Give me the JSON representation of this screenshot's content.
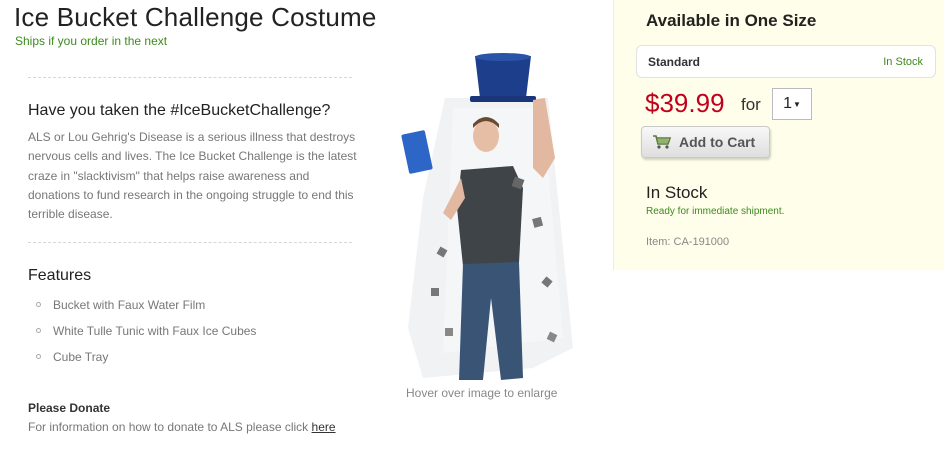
{
  "product": {
    "title": "Ice Bucket Challenge Costume",
    "ships_note": "Ships if you order in the next"
  },
  "description": {
    "heading": "Have you taken the #IceBucketChallenge?",
    "text": "ALS or Lou Gehrig's Disease is a serious illness that destroys nervous cells and lives. The Ice Bucket Challenge is the latest craze in \"slacktivism\" that helps raise awareness and donations to fund research in the ongoing struggle to end this terrible disease."
  },
  "features": {
    "heading": "Features",
    "items": [
      "Bucket with Faux Water Film",
      "White Tulle Tunic with Faux Ice Cubes",
      "Cube Tray"
    ]
  },
  "donate": {
    "heading": "Please Donate",
    "text": "For information on how to donate to ALS please click",
    "link_text": "here"
  },
  "image": {
    "hover_note": "Hover over image to enlarge"
  },
  "purchase": {
    "availability_title": "Available in One Size",
    "size_name": "Standard",
    "size_stock": "In Stock",
    "price": "$39.99",
    "for_label": "for",
    "quantity": "1",
    "add_to_cart": "Add to Cart",
    "stock_title": "In Stock",
    "stock_note": "Ready for immediate shipment.",
    "item_number": "Item: CA-191000"
  },
  "colors": {
    "price_red": "#c0001c",
    "stock_green": "#3d8b1f",
    "panel_bg": "#fefeea"
  },
  "icons": {
    "cart": "shopping-cart-icon",
    "dropdown": "chevron-down-icon"
  }
}
